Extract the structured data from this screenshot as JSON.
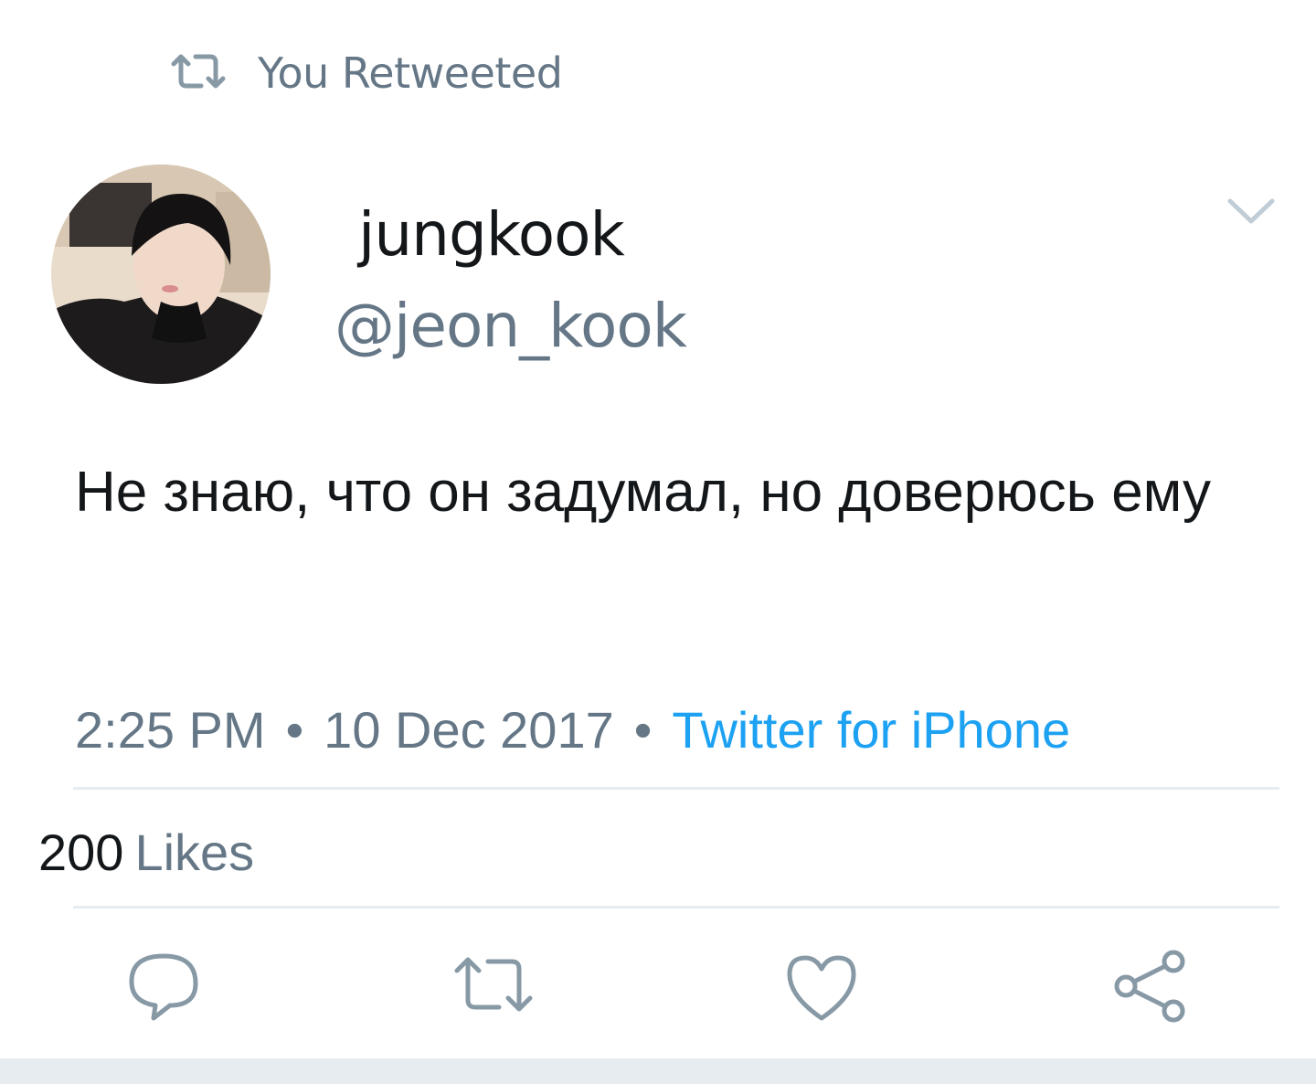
{
  "retweet": {
    "label": "You Retweeted"
  },
  "author": {
    "display_name": "jungkook",
    "handle": "@jeon_kook"
  },
  "tweet": {
    "text": "Не знаю, что он задумал, но доверюсь ему"
  },
  "meta": {
    "time": "2:25 PM",
    "date": "10 Dec 2017",
    "separator": "•",
    "source": "Twitter for iPhone"
  },
  "stats": {
    "likes_count": "200",
    "likes_label": "Likes"
  },
  "icons": {
    "retweet_indicator": "retweet-icon",
    "menu": "chevron-down-icon",
    "reply": "reply-icon",
    "retweet": "retweet-icon",
    "like": "heart-icon",
    "share": "share-icon"
  },
  "colors": {
    "link": "#1da1f2",
    "secondary_text": "#657786",
    "primary_text": "#14171a",
    "divider": "#e6ecf0"
  }
}
